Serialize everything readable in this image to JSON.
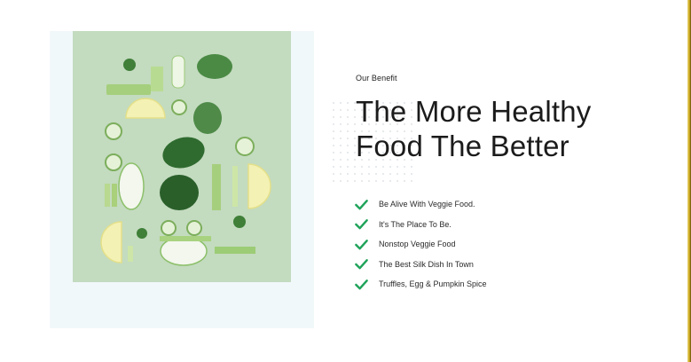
{
  "section": {
    "eyebrow": "Our Benefit",
    "headline_line1": "The More Healthy",
    "headline_line2": "Food The Better",
    "benefits": [
      "Be Alive With Veggie Food.",
      "It's The Place To Be.",
      "Nonstop Veggie Food",
      "The Best Silk Dish In Town",
      "Truffles, Egg & Pumpkin Spice"
    ]
  },
  "colors": {
    "check": "#1fa35a",
    "photo_background": "#c3dbbf",
    "frame_background": "#f1f8fa"
  },
  "image": {
    "subject": "flat-lay of sliced green vegetables"
  }
}
